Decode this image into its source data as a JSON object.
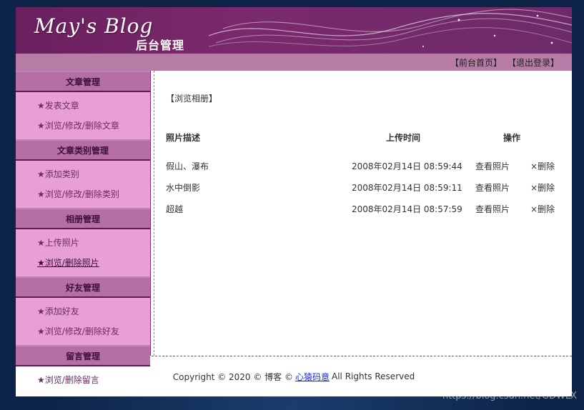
{
  "header": {
    "logo_text": "May's Blog",
    "subtitle": "后台管理"
  },
  "topbar": {
    "home_link": "【前台首页】",
    "logout_link": "【退出登录】"
  },
  "sidebar": {
    "sections": [
      {
        "title": "文章管理",
        "items": [
          "★发表文章",
          "★浏览/修改/删除文章"
        ]
      },
      {
        "title": "文章类别管理",
        "items": [
          "★添加类别",
          "★浏览/修改/删除类别"
        ]
      },
      {
        "title": "相册管理",
        "items": [
          "★上传照片",
          "★浏览/删除照片"
        ]
      },
      {
        "title": "好友管理",
        "items": [
          "★添加好友",
          "★浏览/修改/删除好友"
        ]
      },
      {
        "title": "留言管理",
        "items": [
          "★浏览/删除留言"
        ]
      }
    ]
  },
  "content": {
    "breadcrumb": "【浏览相册】",
    "table": {
      "headers": [
        "照片描述",
        "上传时间",
        "操作"
      ],
      "rows": [
        {
          "desc": "假山、瀑布",
          "time": "2008年02月14日 08:59:44",
          "view": "查看照片",
          "delete": "×删除"
        },
        {
          "desc": "水中倒影",
          "time": "2008年02月14日 08:59:11",
          "view": "查看照片",
          "delete": "×删除"
        },
        {
          "desc": "超越",
          "time": "2008年02月14日 08:57:59",
          "view": "查看照片",
          "delete": "×删除"
        }
      ]
    }
  },
  "footer": {
    "prefix": "Copyright © 2020 © 博客 ©",
    "brand": "心猿码意",
    "suffix": "All Rights Reserved"
  },
  "watermark": "https://blog.csdn.net/GDWLX",
  "colors": {
    "header": "#6a1f5e",
    "topbar": "#b77ca6",
    "sidebar": "#e89fd6",
    "section_head": "#b66fa4",
    "brand_link": "#1b2fc9"
  }
}
